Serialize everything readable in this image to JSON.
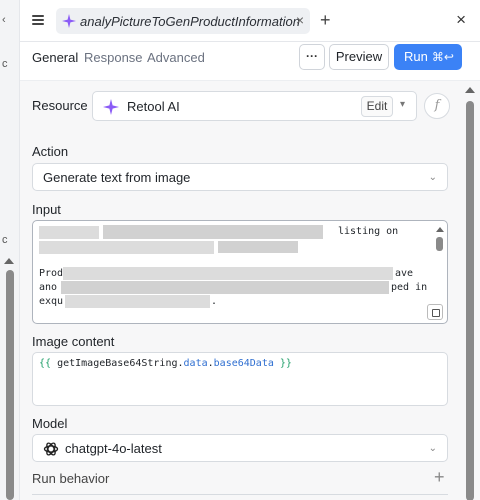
{
  "left_panel": {
    "top_glyph": "‹",
    "mid_glyph_1": "c",
    "mid_glyph_2": "c"
  },
  "titlebar": {
    "tab_label": "analyPictureToGenProductInformation",
    "tab_close": "×",
    "new_tab": "+",
    "close": "×"
  },
  "subtabs": [
    "General",
    "Response",
    "Advanced"
  ],
  "toolbar": {
    "more_label": "···",
    "preview_label": "Preview",
    "run_label": "Run",
    "run_shortcut": "⌘↩"
  },
  "resource": {
    "label": "Resource",
    "name": "Retool AI",
    "edit_label": "Edit",
    "fx_label": "f"
  },
  "action": {
    "label": "Action",
    "value": "Generate text from image"
  },
  "input": {
    "label": "Input",
    "line1_visible": "listing on",
    "line3_start": "Prod",
    "line3_end": "ave",
    "line4_start": "ano",
    "line4_end": "ped in",
    "line5_start": "exqu",
    "line5_end": "."
  },
  "image_content": {
    "label": "Image content",
    "open_brace": "{{",
    "var": "getImageBase64String",
    "prop1": "data",
    "prop2": "base64Data",
    "close_brace": "}}"
  },
  "model": {
    "label": "Model",
    "value": "chatgpt-4o-latest"
  },
  "run_behavior": {
    "label": "Run behavior",
    "add": "+"
  },
  "colors": {
    "accent": "#3b82f6",
    "sparkle": "#8b5cf6",
    "code_brace": "#22a06b",
    "code_prop": "#2f6fd1"
  }
}
